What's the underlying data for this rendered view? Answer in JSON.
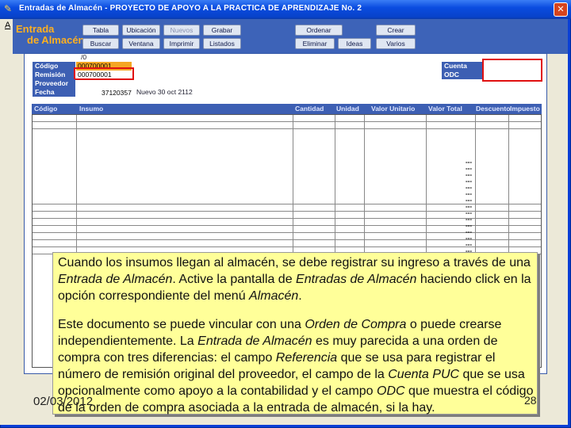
{
  "window": {
    "title": "Entradas de Almacén - PROYECTO DE APOYO A LA PRACTICA DE APRENDIZAJE No. 2",
    "close_glyph": "✕",
    "min_glyph": "_",
    "app_icon": "folder-star-icon"
  },
  "menu": {
    "first_letter": "A"
  },
  "logo": {
    "line1": "Entrada",
    "line2": "de Almacén"
  },
  "toolbar": {
    "row1": [
      "Tabla",
      "Ubicación",
      "Nuevos",
      "Grabar",
      "Ordenar",
      "Crear"
    ],
    "row2": [
      "Buscar",
      "Ventana",
      "Imprimir",
      "Listados",
      "Eliminar",
      "Ideas",
      "Varios"
    ]
  },
  "form": {
    "labels": {
      "codigo": "Código",
      "remision": "Remisión",
      "proveedor": "Proveedor",
      "fecha": "Fecha"
    },
    "values": {
      "codigo": "000700001",
      "remision": "000700001",
      "fecha_code": "37120357",
      "fecha_text": "Nuevo 30 oct 2112",
      "top_hint": "/0"
    },
    "right_labels": {
      "cuenta_puc": "Cuenta PUC",
      "odc": "ODC"
    }
  },
  "grid": {
    "headers": [
      "Código",
      "Insumo",
      "Cantidad",
      "Unidad",
      "Valor Unitario",
      "Valor Total",
      "Descuento",
      "Impuesto"
    ],
    "row_marker": "---"
  },
  "tooltip": {
    "p1_a": "Cuando los insumos llegan al almacén, se debe registrar su ingreso a través de una ",
    "p1_b": "Entrada de Almacén",
    "p1_c": ". Active la pantalla de ",
    "p1_d": "Entradas de Almacén",
    "p1_e": " haciendo click en la opción correspondiente del menú ",
    "p1_f": "Almacén",
    "p1_g": ".",
    "p2_a": "Este documento se puede vincular con una ",
    "p2_b": "Orden de Compra",
    "p2_c": " o puede crearse independientemente. La ",
    "p2_d": "Entrada de Almacén",
    "p2_e": " es muy parecida a una orden de compra con tres diferencias: el campo ",
    "p2_f": "Referencia",
    "p2_g": " que se usa para registrar el número de remisión original del proveedor, el campo de la ",
    "p2_h": "Cuenta PUC",
    "p2_i": " que se usa opcionalmente como apoyo a la contabilidad y el campo ",
    "p2_j": "ODC",
    "p2_k": " que muestra el código de la orden de compra asociada a la entrada de almacén, si la hay."
  },
  "footer": {
    "date": "02/03/2012",
    "page": "28"
  }
}
